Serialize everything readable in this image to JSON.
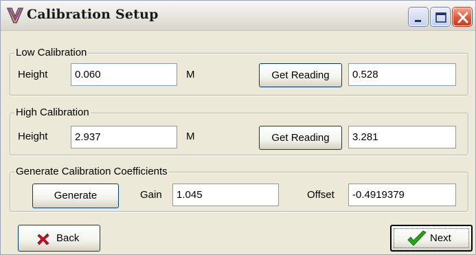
{
  "window": {
    "title": "Calibration Setup",
    "app_icon": "checkmark-v-icon",
    "controls": {
      "minimize": "minimize-icon",
      "maximize": "maximize-icon",
      "close": "close-icon"
    }
  },
  "low_calibration": {
    "legend": "Low Calibration",
    "height_label": "Height",
    "height_value": "0.060",
    "unit": "M",
    "get_reading_label": "Get Reading",
    "reading_value": "0.528"
  },
  "high_calibration": {
    "legend": "High Calibration",
    "height_label": "Height",
    "height_value": "2.937",
    "unit": "M",
    "get_reading_label": "Get Reading",
    "reading_value": "3.281"
  },
  "coefficients": {
    "legend": "Generate Calibration Coefficients",
    "generate_label": "Generate",
    "gain_label": "Gain",
    "gain_value": "1.045",
    "offset_label": "Offset",
    "offset_value": "-0.4919379"
  },
  "footer": {
    "back_label": "Back",
    "back_icon": "red-x-icon",
    "next_label": "Next",
    "next_icon": "green-check-icon"
  },
  "colors": {
    "dialog_bg": "#ece9d8",
    "close_button": "#e0573a",
    "back_icon": "#c8102e",
    "next_icon": "#2aa51c"
  }
}
